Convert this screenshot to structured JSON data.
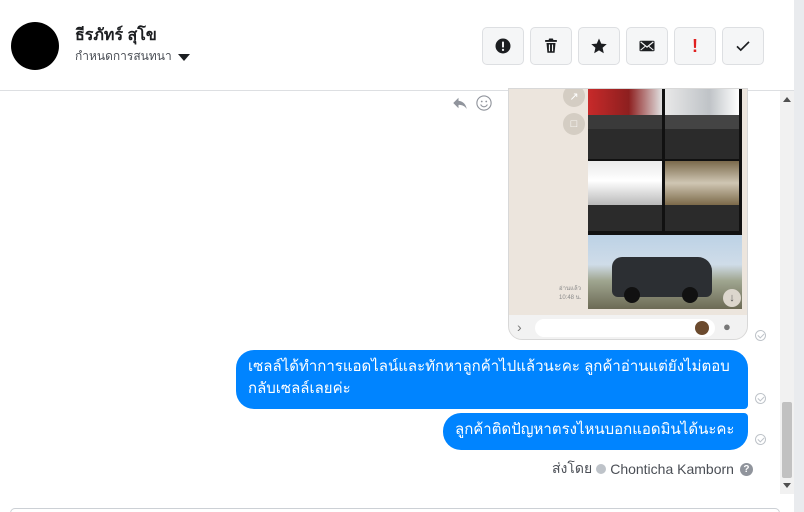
{
  "header": {
    "contact_name": "ธีรภัทร์ สุโข",
    "settings_label": "กำหนดการสนทนา",
    "actions": [
      {
        "icon": "alert-circle-icon",
        "name": "report-button"
      },
      {
        "icon": "trash-icon",
        "name": "delete-button"
      },
      {
        "icon": "star-icon",
        "name": "star-button"
      },
      {
        "icon": "mail-icon",
        "name": "mark-unread-button"
      },
      {
        "icon": "exclamation-icon",
        "name": "spam-button"
      },
      {
        "icon": "check-icon",
        "name": "mark-done-button"
      }
    ]
  },
  "messages": [
    {
      "type": "image",
      "description_icon": "screenshot-thumbnail"
    },
    {
      "type": "text",
      "text": "เซลล์ได้ทำการแอดไลน์และทักหาลูกค้าไปแล้วนะคะ ลูกค้าอ่านแต่ยังไม่ตอบกลับเซลล์เลยค่ะ"
    },
    {
      "type": "text",
      "text": "ลูกค้าติดปัญหาตรงไหนบอกแอดมินได้นะคะ"
    }
  ],
  "sent_by": {
    "label": "ส่งโดย",
    "name": "Chonticha Kamborn",
    "help": "?"
  },
  "colors": {
    "bubble": "#0084ff",
    "header_border": "#dddfe2",
    "spam_red": "#e02020"
  }
}
